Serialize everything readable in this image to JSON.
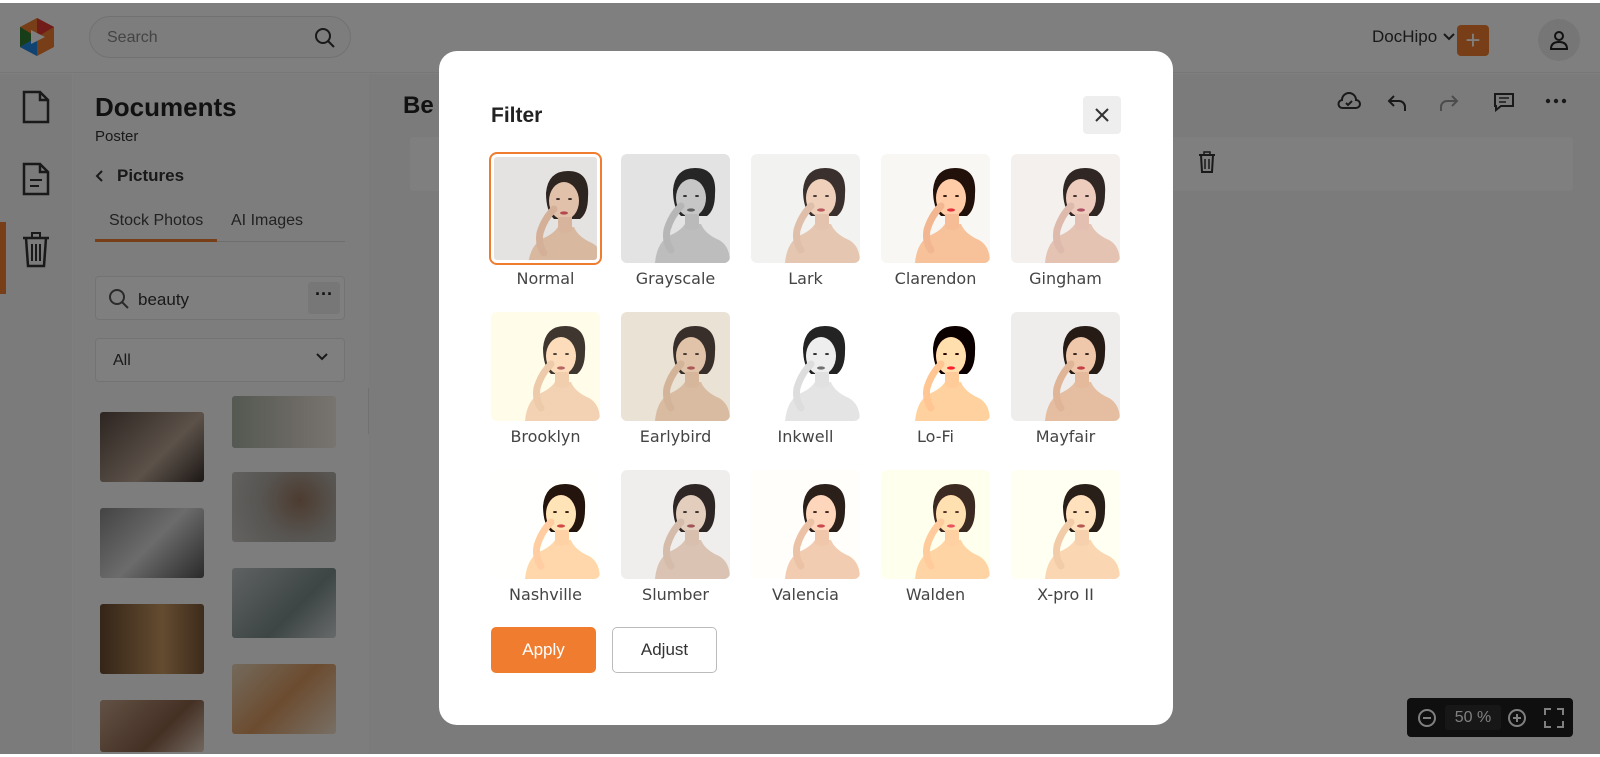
{
  "topbar": {
    "search_placeholder": "Search",
    "brand": "DocHipo"
  },
  "sidebar": {
    "panel_title": "Documents",
    "panel_subtitle": "Poster",
    "back_label": "Pictures",
    "tabs": [
      "Stock Photos",
      "AI Images"
    ],
    "search_value": "beauty",
    "category": "All"
  },
  "canvas": {
    "doc_title_partial": "Be",
    "zoom": "50",
    "zoom_unit": "%"
  },
  "modal": {
    "title": "Filter",
    "filters": [
      "Normal",
      "Grayscale",
      "Lark",
      "Clarendon",
      "Gingham",
      "Brooklyn",
      "Earlybird",
      "Inkwell",
      "Lo-Fi",
      "Mayfair",
      "Nashville",
      "Slumber",
      "Valencia",
      "Walden",
      "X-pro II"
    ],
    "selected": "Normal",
    "apply_label": "Apply",
    "adjust_label": "Adjust"
  },
  "colors": {
    "accent": "#f07d2f",
    "overlay": "rgba(0,0,0,0.5)"
  }
}
